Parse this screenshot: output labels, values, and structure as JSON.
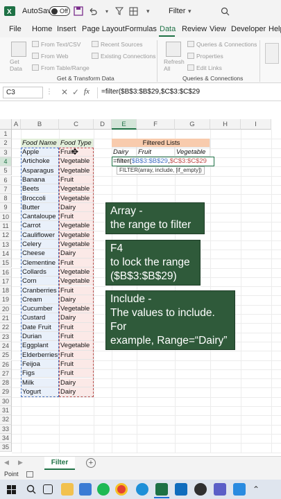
{
  "titlebar": {
    "autosave_label": "AutoSave",
    "toggle_label": "Off",
    "filename": "Filter"
  },
  "menu": [
    "File",
    "Home",
    "Insert",
    "Page Layout",
    "Formulas",
    "Data",
    "Review",
    "View",
    "Developer",
    "Help"
  ],
  "active_menu": "Data",
  "ribbon": {
    "get_data": "Get Data",
    "from_text": "From Text/CSV",
    "from_web": "From Web",
    "from_table": "From Table/Range",
    "recent": "Recent Sources",
    "existing": "Existing Connections",
    "group1": "Get & Transform Data",
    "refresh": "Refresh All",
    "queries_conn": "Queries & Connections",
    "properties": "Properties",
    "edit_links": "Edit Links",
    "group2": "Queries & Connections"
  },
  "formula_bar": {
    "namebox": "C3",
    "fx": "fx",
    "formula": "=filter($B$3:$B$29,$C$3:$C$29"
  },
  "columns": [
    "A",
    "B",
    "C",
    "D",
    "E",
    "F",
    "G",
    "H",
    "I"
  ],
  "rows": [
    "1",
    "2",
    "3",
    "4",
    "5",
    "6",
    "7",
    "8",
    "9",
    "10",
    "11",
    "12",
    "13",
    "14",
    "15",
    "16",
    "17",
    "18",
    "19",
    "20",
    "21",
    "22",
    "23",
    "24",
    "25",
    "26",
    "27",
    "28",
    "29",
    "30",
    "31",
    "32",
    "33",
    "34",
    "35"
  ],
  "headers": {
    "food_name": "Food Name",
    "food_type": "Food Type"
  },
  "foods": [
    [
      "Apple",
      "Fruit"
    ],
    [
      "Artichoke",
      "Vegetable"
    ],
    [
      "Asparagus",
      "Vegetable"
    ],
    [
      "Banana",
      "Fruit"
    ],
    [
      "Beets",
      "Vegetable"
    ],
    [
      "Broccoli",
      "Vegetable"
    ],
    [
      "Butter",
      "Dairy"
    ],
    [
      "Cantaloupe",
      "Fruit"
    ],
    [
      "Carrot",
      "Vegetable"
    ],
    [
      "Cauliflower",
      "Vegetable"
    ],
    [
      "Celery",
      "Vegetable"
    ],
    [
      "Cheese",
      "Dairy"
    ],
    [
      "Clementine",
      "Fruit"
    ],
    [
      "Collards",
      "Vegetable"
    ],
    [
      "Corn",
      "Vegetable"
    ],
    [
      "Cranberries",
      "Fruit"
    ],
    [
      "Cream",
      "Dairy"
    ],
    [
      "Cucumber",
      "Vegetable"
    ],
    [
      "Custard",
      "Dairy"
    ],
    [
      "Date Fruit",
      "Fruit"
    ],
    [
      "Durian",
      "Fruit"
    ],
    [
      "Eggplant",
      "Vegetable"
    ],
    [
      "Elderberries",
      "Fruit"
    ],
    [
      "Feijoa",
      "Fruit"
    ],
    [
      "Figs",
      "Fruit"
    ],
    [
      "Milk",
      "Dairy"
    ],
    [
      "Yogurt",
      "Dairy"
    ]
  ],
  "filtered": {
    "title": "Filtered Lists",
    "dairy": "Dairy",
    "fruit": "Fruit",
    "vegetable": "Vegetable",
    "formula_prefix": "=filter(",
    "formula_arg1": "$B$3:$B$29",
    "formula_sep": ",",
    "formula_arg2": "$C$3:$C$29",
    "tooltip": "FILTER(array, include, [if_empty])"
  },
  "callouts": {
    "array_line1": "Array -",
    "array_line2": "the range to filter",
    "f4_line1": "F4",
    "f4_line2": "to lock the range",
    "f4_line3": "($B$3:$B$29)",
    "include_line1": "Include -",
    "include_line2": "The values to include. For",
    "include_line3": "example, Range=“Dairy”"
  },
  "sheet_tab": "Filter",
  "status": "Point",
  "colors": {
    "excel_green": "#1e7145",
    "callout_bg": "#2f5a3a",
    "header_green": "#e2efda",
    "filtered_header": "#f8cbad",
    "array_blue": "#4472c4",
    "include_red": "#c0504d"
  },
  "taskbar_icons": [
    "windows-icon",
    "search-icon",
    "taskview-icon",
    "explorer-icon",
    "store-icon",
    "spotify-icon",
    "chrome-icon",
    "edge-icon",
    "excel-icon",
    "outlook-icon",
    "obs-icon",
    "teams-icon",
    "app-icon"
  ]
}
